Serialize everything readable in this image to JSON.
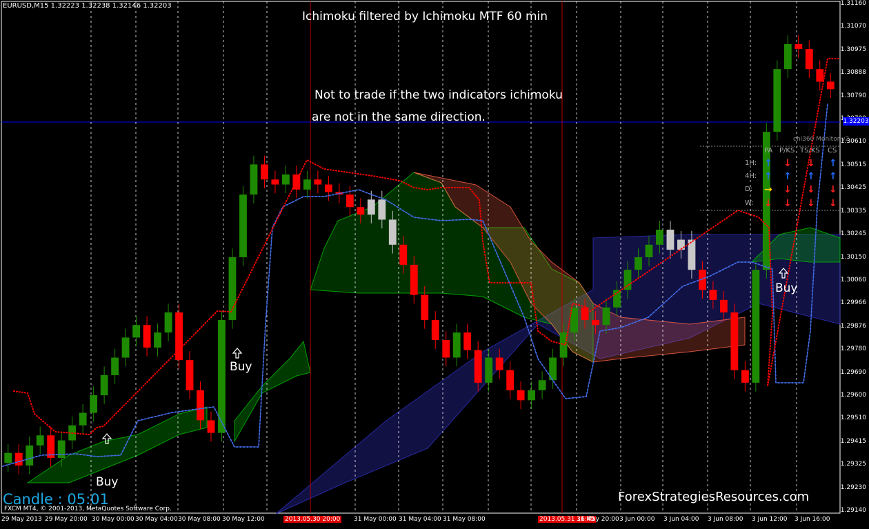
{
  "symbol_info": "EURUSD,M15  1.32223 1.32238 1.32146 1.32203",
  "title": "Ichimoku filtered by Ichimoku MTF 60 min",
  "note_line1": "Not to trade if the two indicators ichimoku",
  "note_line2": "are not in the same direction.",
  "candle_timer": "Candle : 05:01",
  "copyright": "FXCM MT4, © 2001-2013, MetaQuotes Software Corp.",
  "brand": "ForexStrategiesResources.com",
  "buy_labels": [
    "Buy",
    "Buy",
    "Buy"
  ],
  "colors": {
    "bull": "#1e8a00",
    "bear": "#ff0000",
    "neutral": "#c8c8c8",
    "kijun_red": "#ff0000",
    "tenkan_blue": "#4169e1",
    "cloud_green": "#00c000",
    "cloud_red": "#ff6347",
    "cloud_blue": "#3030c0",
    "hline": "#0000ff"
  },
  "monitor": {
    "title": "chi360 Monitor v2",
    "headers": [
      "PA",
      "P/KS",
      "TS/KS",
      "CS"
    ],
    "rows": [
      {
        "label": "1H:",
        "arrows": [
          "up-blue",
          "down-red",
          "down-red",
          "up-blue"
        ]
      },
      {
        "label": "4H:",
        "arrows": [
          "up-blue",
          "up-blue",
          "up-blue",
          "up-blue"
        ]
      },
      {
        "label": "D:",
        "arrows": [
          "right-yellow",
          "down-red",
          "down-red",
          "down-red"
        ]
      },
      {
        "label": "W:",
        "arrows": [
          "down-red",
          "down-red",
          "down-red",
          "down-red"
        ]
      }
    ]
  },
  "current_price": "1.32203",
  "chart_data": {
    "type": "candlestick",
    "title": "Ichimoku filtered by Ichimoku MTF 60 min",
    "y_ticks": [
      "1.31160",
      "1.31070",
      "1.30975",
      "1.30888",
      "1.30790",
      "1.30700",
      "1.30610",
      "1.30515",
      "1.30425",
      "1.30335",
      "1.30245",
      "1.30150",
      "1.30060",
      "1.29966",
      "1.29876",
      "1.29780",
      "1.29690",
      "1.29600",
      "1.29510",
      "1.29415",
      "1.29325",
      "1.29230",
      "1.29140"
    ],
    "ylim": [
      1.2913,
      1.3117
    ],
    "x_ticks": [
      "29 May 2013",
      "29 May 20:00",
      "30 May 00:00",
      "30 May 04:00",
      "30 May 08:00",
      "30 May 12:00",
      "2013.05.30 20:00",
      "31 May 00:00",
      "31 May 04:00",
      "31 May 08:00",
      "2013.05.31 16:45",
      "31 May 20:00",
      "3 Jun 00:00",
      "3 Jun 04:00",
      "3 Jun 08:00",
      "3 Jun 12:00",
      "3 Jun 16:00"
    ],
    "price_path": [
      1.2937,
      1.2932,
      1.294,
      1.2944,
      1.2935,
      1.2942,
      1.2948,
      1.2953,
      1.296,
      1.2968,
      1.2975,
      1.2983,
      1.2988,
      1.2979,
      1.2985,
      1.2993,
      1.2974,
      1.2962,
      1.295,
      1.2945,
      1.299,
      1.3015,
      1.304,
      1.3052,
      1.3046,
      1.3044,
      1.3048,
      1.3042,
      1.3046,
      1.3044,
      1.3041,
      1.304,
      1.3035,
      1.3032,
      1.3038,
      1.303,
      1.302,
      1.3012,
      1.3,
      1.299,
      1.2982,
      1.2975,
      1.2985,
      1.2978,
      1.2965,
      1.2975,
      1.297,
      1.2962,
      1.2958,
      1.2962,
      1.2966,
      1.2975,
      1.2985,
      1.2995,
      1.299,
      1.2988,
      1.2995,
      1.3002,
      1.301,
      1.3015,
      1.302,
      1.3026,
      1.3018,
      1.3022,
      1.301,
      1.3002,
      1.2998,
      1.2993,
      1.297,
      1.2965,
      1.301,
      1.3065,
      1.309,
      1.31,
      1.3098,
      1.309,
      1.3085,
      1.3082
    ],
    "buy_signals": [
      {
        "label": "Buy",
        "x": "29 May 22:00",
        "y": 1.2944
      },
      {
        "label": "Buy",
        "x": "30 May 12:00",
        "y": 1.2977
      },
      {
        "label": "Buy",
        "x": "3 Jun 12:00",
        "y": 1.3004
      }
    ]
  }
}
